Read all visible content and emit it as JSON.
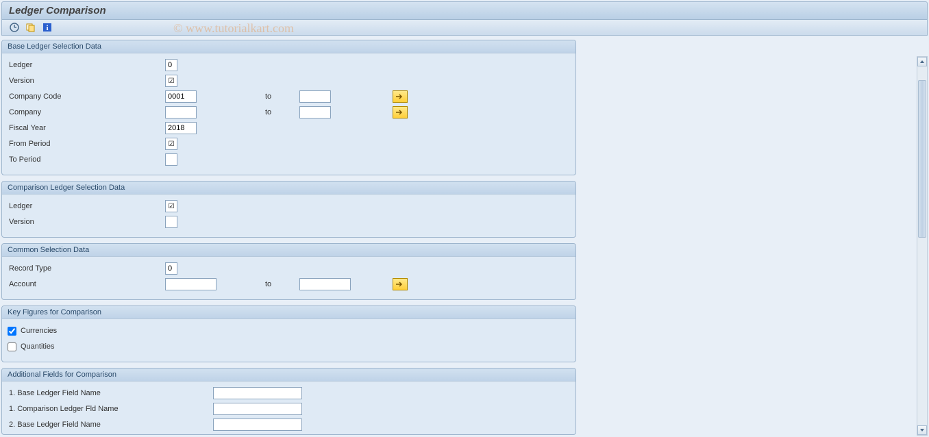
{
  "title": "Ledger Comparison",
  "watermark": "© www.tutorialkart.com",
  "icons": {
    "execute": "execute-icon",
    "variant": "get-variant-icon",
    "info": "info-icon"
  },
  "groups": {
    "base": {
      "header": "Base Ledger Selection Data",
      "rows": {
        "ledger": {
          "label": "Ledger",
          "value": "0"
        },
        "version": {
          "label": "Version",
          "checked": true
        },
        "company_code": {
          "label": "Company Code",
          "from": "0001",
          "to_label": "to",
          "to": ""
        },
        "company": {
          "label": "Company",
          "from": "",
          "to_label": "to",
          "to": ""
        },
        "fiscal_year": {
          "label": "Fiscal Year",
          "value": "2018"
        },
        "from_period": {
          "label": "From Period",
          "checked": true
        },
        "to_period": {
          "label": "To Period",
          "value": ""
        }
      }
    },
    "comp": {
      "header": "Comparison Ledger Selection Data",
      "rows": {
        "ledger": {
          "label": "Ledger",
          "checked": true
        },
        "version": {
          "label": "Version",
          "value": ""
        }
      }
    },
    "common": {
      "header": "Common Selection Data",
      "rows": {
        "record_type": {
          "label": "Record Type",
          "value": "0"
        },
        "account": {
          "label": "Account",
          "from": "",
          "to_label": "to",
          "to": ""
        }
      }
    },
    "key_figures": {
      "header": "Key Figures for Comparison",
      "rows": {
        "currencies": {
          "label": "Currencies",
          "checked": true
        },
        "quantities": {
          "label": "Quantities",
          "checked": false
        }
      }
    },
    "additional": {
      "header": "Additional Fields for Comparison",
      "rows": {
        "f1": {
          "label": "1. Base Ledger Field Name",
          "value": ""
        },
        "f2": {
          "label": "1. Comparison Ledger Fld Name",
          "value": ""
        },
        "f3": {
          "label": "2. Base Ledger Field Name",
          "value": ""
        }
      }
    }
  }
}
